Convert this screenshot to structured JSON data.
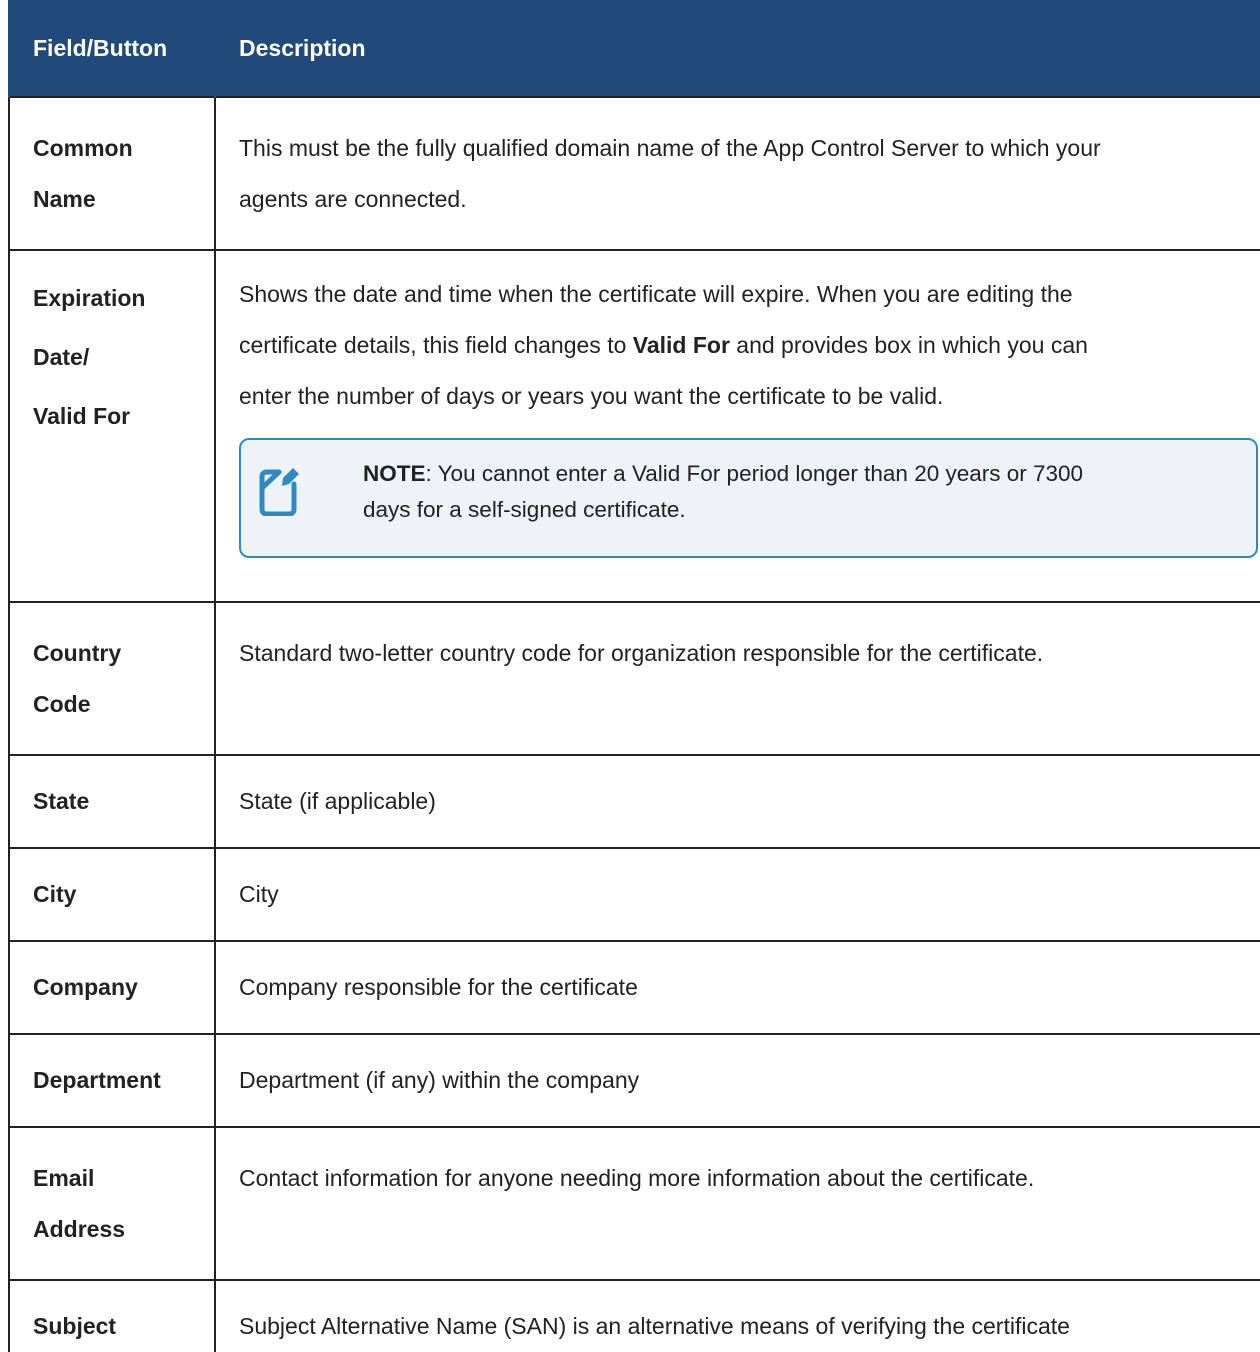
{
  "table": {
    "headers": [
      "Field/Button",
      "Description"
    ],
    "rows": [
      {
        "field_lines": [
          "Common",
          "Name"
        ],
        "description_lines": [
          "This must be the fully qualified domain name of the App Control Server to which your",
          "agents are connected."
        ]
      },
      {
        "field_lines": [
          "Expiration",
          "Date/",
          "Valid For"
        ],
        "description_line1": "Shows the date and time when the certificate will expire. When you are editing the",
        "description_line2_before": "certificate details, this field changes to ",
        "description_line2_bold": "Valid For",
        "description_line2_after": " and provides box in which you can",
        "description_line3": "enter the number of days or years you want the certificate to be valid.",
        "note": {
          "icon": "note-edit-icon",
          "label": "NOTE",
          "text_line1": ": You cannot enter a Valid For period longer than 20 years or 7300",
          "text_line2": "days for a self-signed certificate."
        }
      },
      {
        "field_lines": [
          "Country",
          "Code"
        ],
        "description": "Standard two-letter country code for organization responsible for the certificate."
      },
      {
        "field": "State",
        "description": "State (if applicable)"
      },
      {
        "field": "City",
        "description": "City"
      },
      {
        "field": "Company",
        "description": "Company responsible for the certificate"
      },
      {
        "field": "Department",
        "description": "Department (if any) within the company"
      },
      {
        "field_lines": [
          "Email",
          "Address"
        ],
        "description": "Contact information for anyone needing more information about the certificate."
      },
      {
        "field": "Subject",
        "description": "Subject Alternative Name (SAN) is an alternative means of verifying the certificate"
      }
    ]
  },
  "colors": {
    "header_bg": "#214a7a",
    "note_border": "#2f8ac4",
    "note_bg": "#eef3f7",
    "icon_color": "#2f8ac4"
  }
}
